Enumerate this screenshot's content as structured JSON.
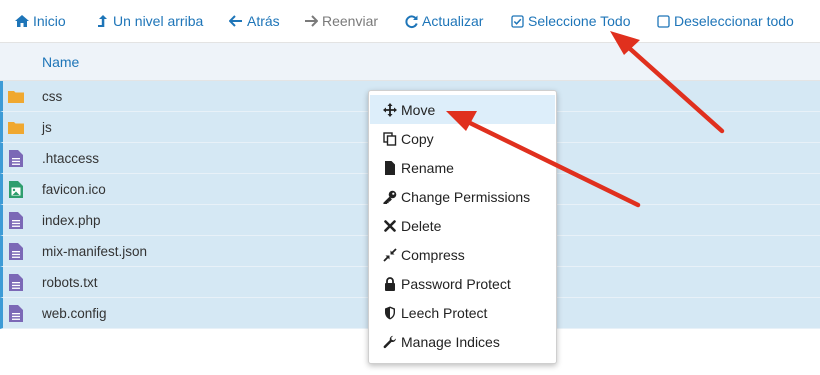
{
  "toolbar": {
    "home_label": "Inicio",
    "up_label": "Un nivel arriba",
    "back_label": "Atrás",
    "forward_label": "Reenviar",
    "refresh_label": "Actualizar",
    "select_all_label": "Seleccione Todo",
    "deselect_all_label": "Deseleccionar todo"
  },
  "table": {
    "column_name": "Name",
    "files": [
      {
        "name": "css",
        "type": "folder"
      },
      {
        "name": "js",
        "type": "folder"
      },
      {
        "name": ".htaccess",
        "type": "file"
      },
      {
        "name": "favicon.ico",
        "type": "image"
      },
      {
        "name": "index.php",
        "type": "file"
      },
      {
        "name": "mix-manifest.json",
        "type": "file"
      },
      {
        "name": "robots.txt",
        "type": "file"
      },
      {
        "name": "web.config",
        "type": "file"
      }
    ]
  },
  "context_menu": {
    "items": [
      {
        "label": "Move",
        "icon": "move-icon"
      },
      {
        "label": "Copy",
        "icon": "copy-icon"
      },
      {
        "label": "Rename",
        "icon": "file-icon"
      },
      {
        "label": "Change Permissions",
        "icon": "key-icon"
      },
      {
        "label": "Delete",
        "icon": "times-icon"
      },
      {
        "label": "Compress",
        "icon": "compress-icon"
      },
      {
        "label": "Password Protect",
        "icon": "lock-icon"
      },
      {
        "label": "Leech Protect",
        "icon": "shield-icon"
      },
      {
        "label": "Manage Indices",
        "icon": "wrench-icon"
      }
    ]
  },
  "colors": {
    "link_blue": "#1e75b8",
    "selected_row": "#d5e8f4",
    "folder": "#f0a830",
    "file": "#7b68b6",
    "image_file": "#2e9e6e",
    "annotation_arrow": "#e0301e"
  }
}
